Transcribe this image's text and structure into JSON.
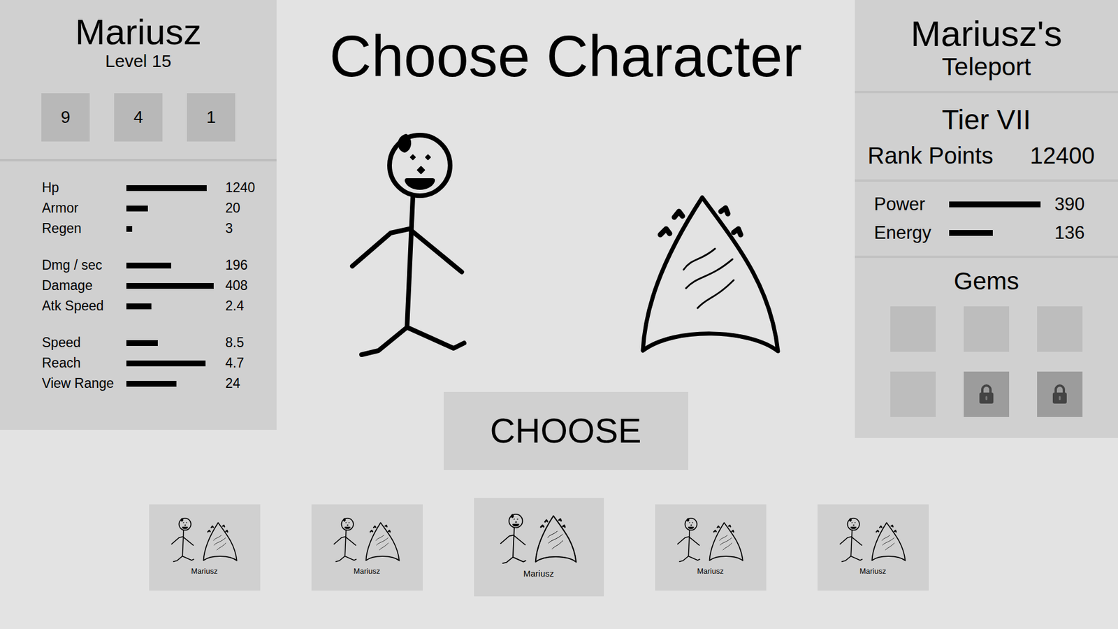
{
  "title": "Choose Character",
  "character": {
    "name": "Mariusz",
    "level": "Level 15",
    "counters": [
      "9",
      "4",
      "1"
    ],
    "stat_groups": [
      [
        {
          "label": "Hp",
          "value": "1240",
          "level": 0.86
        },
        {
          "label": "Armor",
          "value": "20",
          "level": 0.23
        },
        {
          "label": "Regen",
          "value": "3",
          "level": 0.06
        }
      ],
      [
        {
          "label": "Dmg / sec",
          "value": "196",
          "level": 0.48
        },
        {
          "label": "Damage",
          "value": "408",
          "level": 0.94
        },
        {
          "label": "Atk Speed",
          "value": "2.4",
          "level": 0.27
        }
      ],
      [
        {
          "label": "Speed",
          "value": "8.5",
          "level": 0.34
        },
        {
          "label": "Reach",
          "value": "4.7",
          "level": 0.85
        },
        {
          "label": "View Range",
          "value": "24",
          "level": 0.54
        }
      ]
    ]
  },
  "teleport": {
    "title": "Mariusz's",
    "subtitle": "Teleport",
    "tier": "Tier VII",
    "rank_label": "Rank Points",
    "rank_value": "12400",
    "stats": [
      {
        "label": "Power",
        "value": "390",
        "level": 0.92
      },
      {
        "label": "Energy",
        "value": "136",
        "level": 0.44
      }
    ],
    "gems_title": "Gems",
    "gems": [
      {
        "locked": false
      },
      {
        "locked": false
      },
      {
        "locked": false
      },
      {
        "locked": false
      },
      {
        "locked": true
      },
      {
        "locked": true
      }
    ]
  },
  "choose_button": "CHOOSE",
  "loadouts": [
    {
      "name": "Mariusz",
      "selected": false
    },
    {
      "name": "Mariusz",
      "selected": false
    },
    {
      "name": "Mariusz",
      "selected": true
    },
    {
      "name": "Mariusz",
      "selected": false
    },
    {
      "name": "Mariusz",
      "selected": false
    }
  ]
}
